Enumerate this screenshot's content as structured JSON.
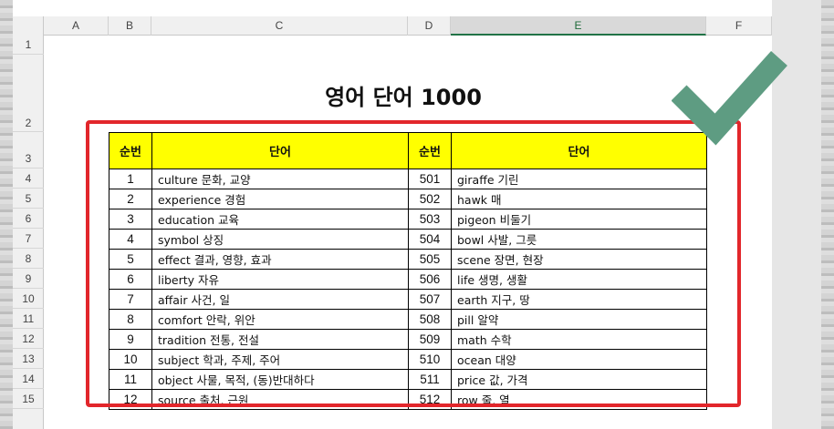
{
  "sheet": {
    "columns": [
      "A",
      "B",
      "C",
      "D",
      "E",
      "F"
    ],
    "selected_column": "E",
    "rows": [
      "1",
      "2",
      "3",
      "4",
      "5",
      "6",
      "7",
      "8",
      "9",
      "10",
      "11",
      "12",
      "13",
      "14",
      "15"
    ],
    "title": "영어 단어 1000"
  },
  "table": {
    "headers": [
      "순번",
      "단어",
      "순번",
      "단어"
    ],
    "rows": [
      {
        "n1": "1",
        "w1": "culture 문화, 교양",
        "n2": "501",
        "w2": "giraffe 기린"
      },
      {
        "n1": "2",
        "w1": "experience 경험",
        "n2": "502",
        "w2": "hawk 매"
      },
      {
        "n1": "3",
        "w1": "education 교육",
        "n2": "503",
        "w2": "pigeon 비둘기"
      },
      {
        "n1": "4",
        "w1": "symbol 상징",
        "n2": "504",
        "w2": "bowl 사발, 그릇"
      },
      {
        "n1": "5",
        "w1": "effect 결과, 영향, 효과",
        "n2": "505",
        "w2": "scene 장면, 현장"
      },
      {
        "n1": "6",
        "w1": "liberty 자유",
        "n2": "506",
        "w2": "life 생명, 생활"
      },
      {
        "n1": "7",
        "w1": "affair 사건, 일",
        "n2": "507",
        "w2": "earth 지구, 땅"
      },
      {
        "n1": "8",
        "w1": "comfort 안락, 위안",
        "n2": "508",
        "w2": "pill 알약"
      },
      {
        "n1": "9",
        "w1": "tradition 전통, 전설",
        "n2": "509",
        "w2": "math 수학"
      },
      {
        "n1": "10",
        "w1": "subject 학과, 주제, 주어",
        "n2": "510",
        "w2": "ocean 대양"
      },
      {
        "n1": "11",
        "w1": "object 사물, 목적, (동)반대하다",
        "n2": "511",
        "w2": "price 값, 가격"
      },
      {
        "n1": "12",
        "w1": "source 출처, 근원",
        "n2": "512",
        "w2": "row 줄, 열"
      }
    ]
  },
  "colors": {
    "header_fill": "#ffff00",
    "highlight_border": "#e2262b",
    "checkmark": "#5e9c82",
    "excel_green": "#217346"
  },
  "icons": {
    "checkmark": "check-icon"
  }
}
